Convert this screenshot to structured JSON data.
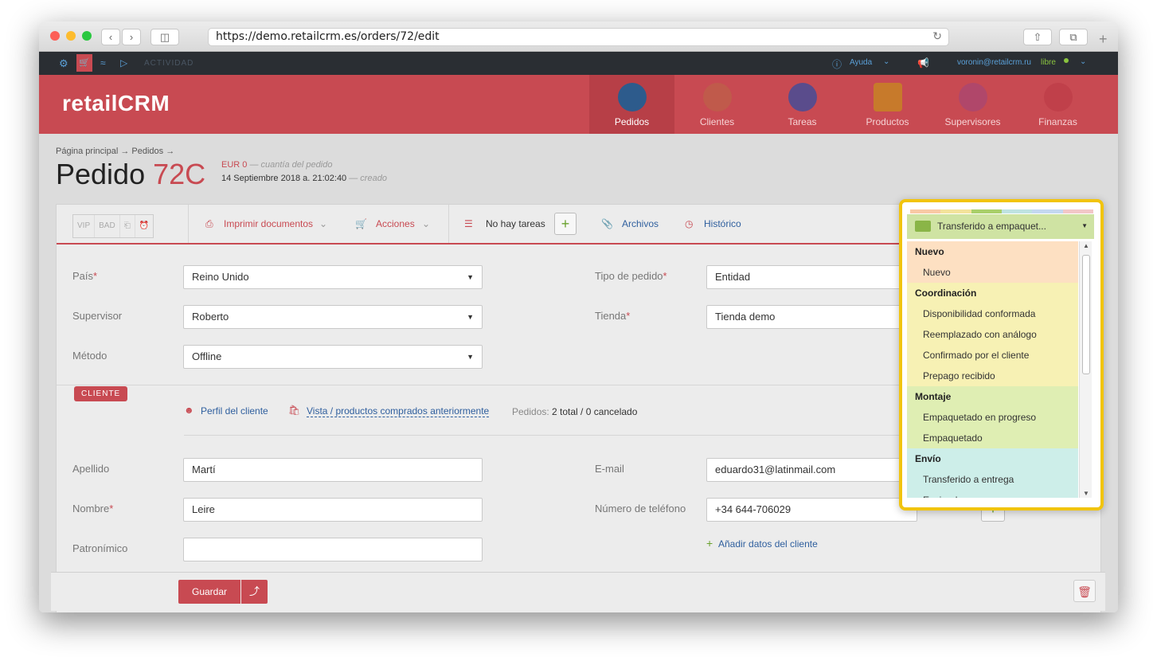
{
  "browser": {
    "url": "https://demo.retailcrm.es/orders/72/edit"
  },
  "topbar": {
    "activity": "ACTIVIDAD",
    "help": "Ayuda",
    "user_email": "voronin@retailcrm.ru",
    "user_status": "libre"
  },
  "header": {
    "logo": "retailCRM",
    "nav": [
      {
        "label": "Pedidos",
        "color": "#2d5b8c"
      },
      {
        "label": "Clientes",
        "color": "#c05a4b"
      },
      {
        "label": "Tareas",
        "color": "#5a4c8c"
      },
      {
        "label": "Productos",
        "color": "#c77a2b"
      },
      {
        "label": "Supervisores",
        "color": "#b0476a"
      },
      {
        "label": "Finanzas",
        "color": "#c0404a"
      }
    ]
  },
  "page": {
    "breadcrumb": "Página principal → Pedidos →",
    "title_prefix": "Pedido",
    "title_number": "72C",
    "amount": "EUR 0",
    "amount_note": "— cuantía del pedido",
    "created": "14 Septiembre 2018 a. 21:02:40",
    "created_note": "— creado"
  },
  "toolbar": {
    "tags": [
      "VIP",
      "BAD",
      "⎗",
      "⏰"
    ],
    "print": "Imprimir documentos",
    "actions": "Acciones",
    "tasks": "No hay tareas",
    "files": "Archivos",
    "history": "Histórico"
  },
  "form": {
    "country_label": "País",
    "country_value": "Reino Unido",
    "supervisor_label": "Supervisor",
    "supervisor_value": "Roberto",
    "method_label": "Método",
    "method_value": "Offline",
    "order_type_label": "Tipo de pedido",
    "order_type_value": "Entidad",
    "store_label": "Tienda",
    "store_value": "Tienda demo"
  },
  "client": {
    "badge": "CLIENTE",
    "profile_link": "Perfil del cliente",
    "history_link": "Vista / productos comprados anteriormente",
    "orders_label": "Pedidos:",
    "orders_value": "2 total / 0 cancelado",
    "surname_label": "Apellido",
    "surname_value": "Martí",
    "name_label": "Nombre",
    "name_value": "Leire",
    "patronymic_label": "Patronímico",
    "email_label": "E-mail",
    "email_value": "eduardo31@latinmail.com",
    "phone_label": "Número de teléfono",
    "phone_value": "+34 644-706029",
    "add_data": "Añadir datos del cliente"
  },
  "footer": {
    "save": "Guardar"
  },
  "status_dropdown": {
    "selected": "Transferido a empaquet...",
    "stripe_colors": [
      "#f9c9a5",
      "#f3e39b",
      "#d7e7a6",
      "#bfe3e1",
      "#c4d8f0",
      "#f2c7c7"
    ],
    "groups": [
      {
        "name": "Nuevo",
        "color": "#fde0c2",
        "items": [
          "Nuevo"
        ]
      },
      {
        "name": "Coordinación",
        "color": "#f7f1b4",
        "items": [
          "Disponibilidad conformada",
          "Reemplazado con análogo",
          "Confirmado por el cliente",
          "Prepago recibido"
        ]
      },
      {
        "name": "Montaje",
        "color": "#dfeeb3",
        "items": [
          "Empaquetado en progreso",
          "Empaquetado"
        ]
      },
      {
        "name": "Envío",
        "color": "#cdeee9",
        "items": [
          "Transferido a entrega",
          "Enviando"
        ]
      }
    ]
  }
}
